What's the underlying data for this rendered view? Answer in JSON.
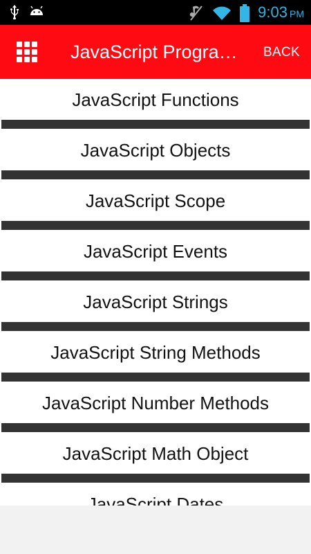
{
  "status_bar": {
    "time": "9:03",
    "ampm": "PM",
    "icons": [
      "usb-icon",
      "android-icon",
      "mute-icon",
      "wifi-icon",
      "battery-icon"
    ]
  },
  "action_bar": {
    "title": "JavaScript Progra…",
    "back_label": "BACK",
    "menu_icon": "grid-menu-icon",
    "color": "#fe0a13"
  },
  "list": {
    "items": [
      {
        "label": "JavaScript Functions"
      },
      {
        "label": "JavaScript Objects"
      },
      {
        "label": "JavaScript Scope"
      },
      {
        "label": "JavaScript Events"
      },
      {
        "label": "JavaScript Strings"
      },
      {
        "label": "JavaScript String Methods"
      },
      {
        "label": "JavaScript Number Methods"
      },
      {
        "label": "JavaScript Math Object"
      },
      {
        "label": "JavaScript Dates"
      }
    ],
    "separator_color": "#333333"
  }
}
